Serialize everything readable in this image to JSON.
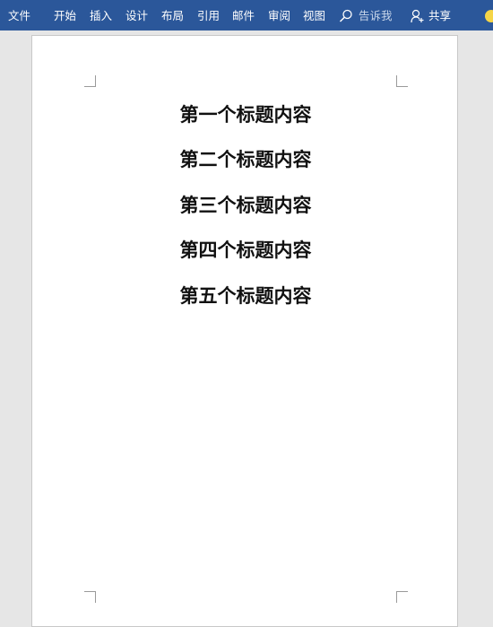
{
  "ribbon": {
    "background": "#2b579a",
    "tabs": [
      "文件",
      "开始",
      "插入",
      "设计",
      "布局",
      "引用",
      "邮件",
      "审阅",
      "视图"
    ],
    "tell_me": {
      "label": "告诉我",
      "icon": "search-icon"
    },
    "share": {
      "label": "共享",
      "icon": "user-share-icon"
    },
    "feedback_icon": "smiley-icon"
  },
  "document": {
    "headings": [
      "第一个标题内容",
      "第二个标题内容",
      "第三个标题内容",
      "第四个标题内容",
      "第五个标题内容"
    ]
  }
}
